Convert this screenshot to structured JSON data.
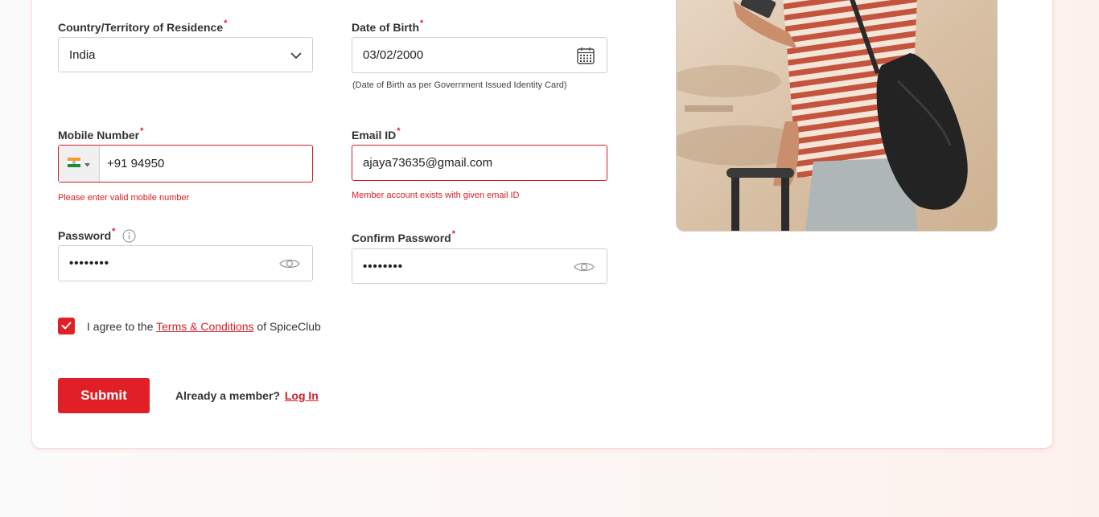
{
  "form": {
    "country": {
      "label": "Country/Territory of Residence",
      "required_mark": "*",
      "value": "India"
    },
    "dob": {
      "label": "Date of Birth",
      "required_mark": "*",
      "value": "03/02/2000",
      "help": "(Date of Birth as per Government Issued Identity Card)"
    },
    "mobile": {
      "label": "Mobile Number",
      "required_mark": "*",
      "value": "+91 94950",
      "error": "Please enter valid mobile number",
      "flag": "india-flag-icon"
    },
    "email": {
      "label": "Email ID",
      "required_mark": "*",
      "value": "ajaya73635@gmail.com",
      "error": "Member account exists with given email ID"
    },
    "password": {
      "label": "Password",
      "required_mark": "*",
      "value": "••••••••"
    },
    "confirm_password": {
      "label": "Confirm Password",
      "required_mark": "*",
      "value": "••••••••"
    },
    "terms": {
      "checked": true,
      "prefix": "I agree to the ",
      "link": "Terms & Conditions",
      "suffix": " of SpiceClub"
    },
    "submit_label": "Submit",
    "member_prompt": "Already a member?",
    "login_link": "Log In"
  },
  "colors": {
    "brand_red": "#e01f26",
    "error_red": "#d0202a",
    "border": "#cfcfcf"
  },
  "icons": [
    "chevron-down-icon",
    "calendar-icon",
    "info-icon",
    "eye-icon",
    "checkmark-icon",
    "caret-down-icon"
  ]
}
